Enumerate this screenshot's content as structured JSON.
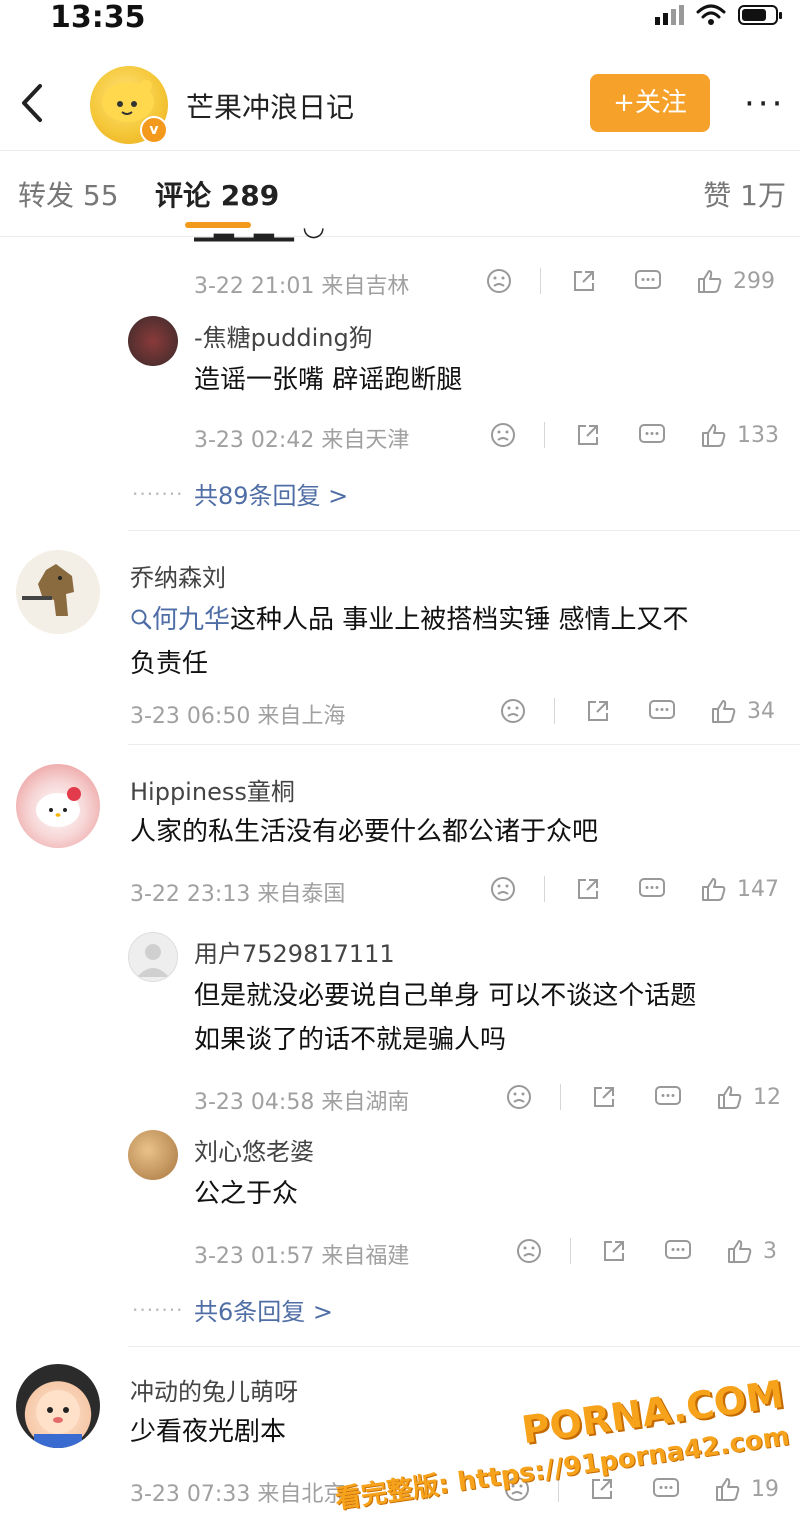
{
  "status_bar": {
    "time": "13:35"
  },
  "header": {
    "title": "芒果冲浪日记",
    "follow_label": "+关注",
    "more": "···"
  },
  "tabs": {
    "repost": "转发 55",
    "comments": "评论 289",
    "likes": "赞 1万"
  },
  "comments": [
    {
      "meta": "3-22 21:01 来自吉林",
      "likes": "299"
    },
    {
      "name": "-焦糖pudding狗",
      "text": "造谣一张嘴 辟谣跑断腿",
      "meta": "3-23 02:42 来自天津",
      "likes": "133"
    },
    {
      "more": "共89条回复 >"
    },
    {
      "name": "乔纳森刘",
      "topic": "何九华",
      "text_line1": "这种人品 事业上被搭档实锤 感情上又不",
      "text_line2": "负责任",
      "meta": "3-23 06:50 来自上海",
      "likes": "34"
    },
    {
      "name": "Hippiness童桐",
      "text": "人家的私生活没有必要什么都公诸于众吧",
      "meta": "3-22 23:13 来自泰国",
      "likes": "147"
    },
    {
      "name": "用户7529817111",
      "text_line1": "但是就没必要说自己单身 可以不谈这个话题",
      "text_line2": "如果谈了的话不就是骗人吗",
      "meta": "3-23 04:58 来自湖南",
      "likes": "12"
    },
    {
      "name": "刘心悠老婆",
      "text": "公之于众",
      "meta": "3-23 01:57 来自福建",
      "likes": "3"
    },
    {
      "more": "共6条回复 >"
    },
    {
      "name": "冲动的兔儿萌呀",
      "text": "少看夜光剧本",
      "meta": "3-23 07:33 来自北京",
      "likes": "19"
    }
  ],
  "watermark": {
    "brand": "PORNA.COM",
    "url": "看完整版: https://91porna42.com"
  },
  "icons": [
    "back-icon",
    "more-icon",
    "dislike-icon",
    "share-icon",
    "comment-icon",
    "like-icon",
    "search-icon"
  ],
  "colors": {
    "accent": "#f39a1d",
    "link": "#4f6ea5",
    "meta": "#a0a0a0"
  }
}
